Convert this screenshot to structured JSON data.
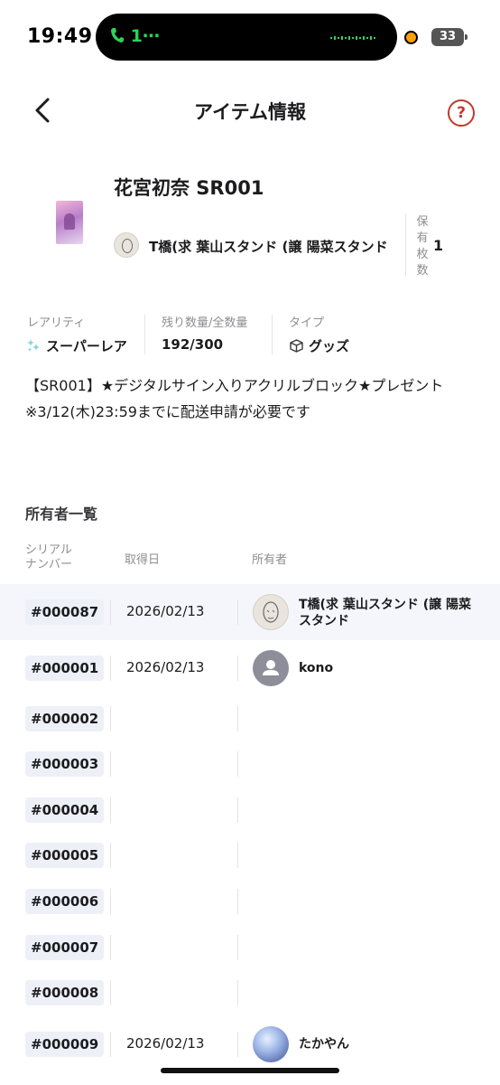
{
  "status_bar": {
    "time": "19:49",
    "call_indicator": "1⋯",
    "battery": "33"
  },
  "nav": {
    "title": "アイテム情報",
    "help_icon": "?"
  },
  "item": {
    "name": "花宮初奈 SR001",
    "seller_name": "T橋(求 葉山スタンド (譲 陽菜スタンド",
    "holding_label": "保有枚数",
    "holding_value": "1"
  },
  "meta": {
    "rarity_label": "レアリティ",
    "rarity_value": "スーパーレア",
    "quantity_label": "残り数量/全数量",
    "quantity_value": "192/300",
    "type_label": "タイプ",
    "type_value": "グッズ"
  },
  "description": {
    "line1": "【SR001】★デジタルサイン入りアクリルブロック★プレゼント",
    "line2": "※3/12(木)23:59までに配送申請が必要です"
  },
  "owners": {
    "section_title": "所有者一覧",
    "col_serial": "シリアルナンバー",
    "col_date": "取得日",
    "col_owner": "所有者",
    "rows": [
      {
        "serial": "#000087",
        "date": "2026/02/13",
        "owner": "T橋(求 葉山スタンド (譲 陽菜スタンド"
      },
      {
        "serial": "#000001",
        "date": "2026/02/13",
        "owner": "kono"
      },
      {
        "serial": "#000002",
        "date": "",
        "owner": ""
      },
      {
        "serial": "#000003",
        "date": "",
        "owner": ""
      },
      {
        "serial": "#000004",
        "date": "",
        "owner": ""
      },
      {
        "serial": "#000005",
        "date": "",
        "owner": ""
      },
      {
        "serial": "#000006",
        "date": "",
        "owner": ""
      },
      {
        "serial": "#000007",
        "date": "",
        "owner": ""
      },
      {
        "serial": "#000008",
        "date": "",
        "owner": ""
      },
      {
        "serial": "#000009",
        "date": "2026/02/13",
        "owner": "たかやん"
      }
    ]
  },
  "colors": {
    "accent_help": "#c0392b",
    "serial_bg": "#eef0f8",
    "highlight_row": "#f5f6fb"
  }
}
